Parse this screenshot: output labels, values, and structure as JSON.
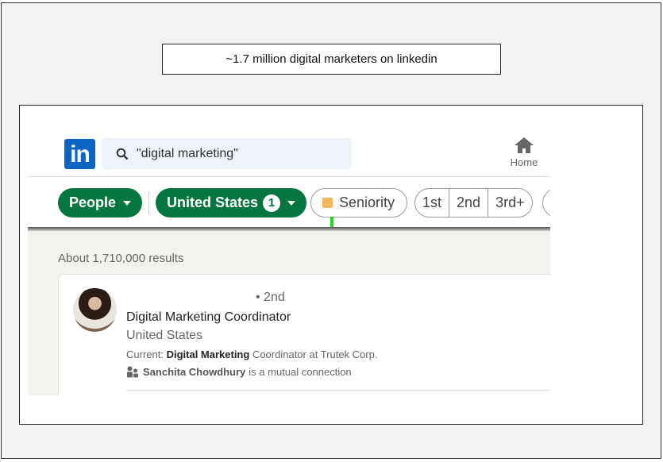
{
  "caption": "~1.7 million digital marketers on linkedin",
  "header": {
    "logo": "in",
    "search_value": "\"digital marketing\"",
    "home_label": "Home"
  },
  "filters": {
    "people": "People",
    "location": "United States",
    "location_count": "1",
    "seniority": "Seniority",
    "degrees": [
      "1st",
      "2nd",
      "3rd+"
    ]
  },
  "results_count": "About 1,710,000 results",
  "result": {
    "degree": "• 2nd",
    "title": "Digital Marketing Coordinator",
    "location": "United States",
    "current_prefix": "Current: ",
    "current_bold": "Digital Marketing",
    "current_rest": " Coordinator at Trutek Corp.",
    "mutual_name": "Sanchita Chowdhury",
    "mutual_rest": "is a mutual connection"
  },
  "colors": {
    "brand": "#0a66c2",
    "pill_green": "#057642"
  }
}
